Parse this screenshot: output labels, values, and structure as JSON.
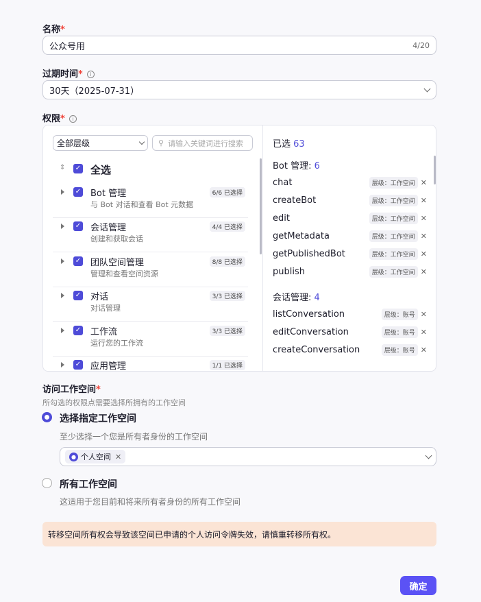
{
  "name": {
    "label": "名称",
    "value": "公众号用",
    "counter": "4/20"
  },
  "expiry": {
    "label": "过期时间",
    "value": "30天（2025-07-31）"
  },
  "permissions": {
    "label": "权限",
    "filter": "全部层级",
    "search_placeholder": "请输入关键词进行搜索",
    "select_all": "全选",
    "groups": [
      {
        "title": "Bot 管理",
        "desc": "与 Bot 对话和查看 Bot 元数据",
        "badge": "6/6 已选择"
      },
      {
        "title": "会话管理",
        "desc": "创建和获取会话",
        "badge": "4/4 已选择"
      },
      {
        "title": "团队空间管理",
        "desc": "管理和查看空间资源",
        "badge": "8/8 已选择"
      },
      {
        "title": "对话",
        "desc": "对话管理",
        "badge": "3/3 已选择"
      },
      {
        "title": "工作流",
        "desc": "运行您的工作流",
        "badge": "3/3 已选择"
      },
      {
        "title": "应用管理",
        "desc": "",
        "badge": "1/1 已选择"
      }
    ],
    "selected_label": "已选",
    "selected_count": "63",
    "sections": [
      {
        "title": "Bot 管理:",
        "count": "6",
        "items": [
          {
            "name": "chat",
            "tag": "层级：工作空间"
          },
          {
            "name": "createBot",
            "tag": "层级：工作空间"
          },
          {
            "name": "edit",
            "tag": "层级：工作空间"
          },
          {
            "name": "getMetadata",
            "tag": "层级：工作空间"
          },
          {
            "name": "getPublishedBot",
            "tag": "层级：工作空间"
          },
          {
            "name": "publish",
            "tag": "层级：工作空间"
          }
        ]
      },
      {
        "title": "会话管理:",
        "count": "4",
        "items": [
          {
            "name": "listConversation",
            "tag": "层级：账号"
          },
          {
            "name": "editConversation",
            "tag": "层级：账号"
          },
          {
            "name": "createConversation",
            "tag": "层级：账号"
          }
        ]
      }
    ]
  },
  "workspace": {
    "label": "访问工作空间",
    "desc": "所勾选的权限点需要选择所拥有的工作空间",
    "option1": "选择指定工作空间",
    "option1_hint": "至少选择一个您是所有者身份的工作空间",
    "chip": "个人空间",
    "option2": "所有工作空间",
    "option2_hint": "这适用于您目前和将来所有者身份的所有工作空间"
  },
  "warning": "转移空间所有权会导致该空间已申请的个人访问令牌失效，请慎重转移所有权。",
  "confirm": "确定",
  "colors": {
    "accent": "#4e4bd8",
    "warning_bg": "#fbe4d5"
  }
}
